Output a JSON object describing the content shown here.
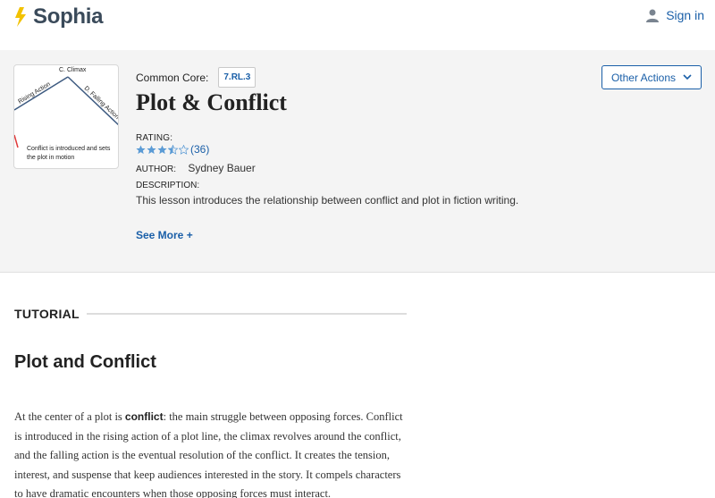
{
  "header": {
    "brand": "Sophia",
    "signin_label": "Sign in",
    "brand_color": "#f2c200",
    "link_color": "#1a5fa8"
  },
  "hero": {
    "thumbnail": {
      "climax_label": "C. Climax",
      "rising_label": "Rising Action",
      "falling_label": "D. Falling Action",
      "caption": "Conflict is introduced and sets the plot in motion"
    },
    "common_core_label": "Common Core:",
    "common_core_tag": "7.RL.3",
    "title": "Plot & Conflict",
    "rating_label": "RATING:",
    "rating_value": 3.5,
    "rating_out_of": 5,
    "rating_count": "(36)",
    "author_label": "AUTHOR:",
    "author_name": "Sydney Bauer",
    "description_label": "DESCRIPTION:",
    "description": "This lesson introduces the relationship between conflict and plot in fiction writing.",
    "see_more": "See More +",
    "other_actions": "Other Actions"
  },
  "content": {
    "tutorial_label": "TUTORIAL",
    "section_title": "Plot and Conflict",
    "para_part1": "At the center of a plot is ",
    "para_bold": "conflict",
    "para_part2": ": the main struggle between opposing forces. Conflict is introduced in the rising action of a plot line, the climax revolves around the conflict, and the falling action is the eventual resolution of the conflict. It creates the tension, interest, and suspense that keep audiences interested in the story. It compels characters to have dramatic encounters when those opposing forces must interact."
  }
}
